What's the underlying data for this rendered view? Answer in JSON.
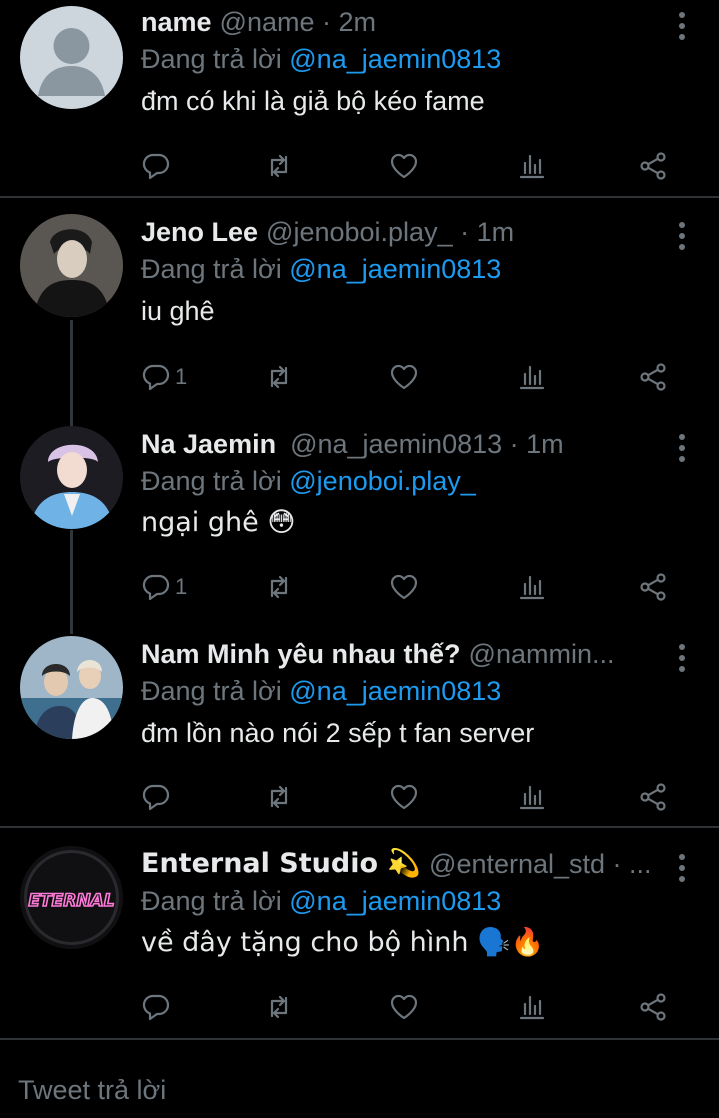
{
  "reply_prefix": "Đang trả lời ",
  "tweets": [
    {
      "name": "name",
      "handle_time": "@name · 2m",
      "reply_to": "@na_jaemin0813",
      "text": "đm có khi là giả bộ kéo fame",
      "reply_count": "",
      "avatar": "default-avatar"
    },
    {
      "name": "Jeno Lee",
      "handle_time": "@jenoboi.play_ · 1m",
      "reply_to": "@na_jaemin0813",
      "text": "iu ghê",
      "reply_count": "1",
      "avatar": "photo-avatar"
    },
    {
      "name": "Na Jaemin",
      "handle_time": "@na_jaemin0813 · 1m",
      "reply_to": "@jenoboi.play_",
      "text": "ngại ghê 😳",
      "reply_count": "1",
      "avatar": "photo-avatar"
    },
    {
      "name": "Nam Minh yêu nhau thế?",
      "handle_time": "@nammin...",
      "reply_to": "@na_jaemin0813",
      "text": "đm lồn nào nói 2 sếp t fan server",
      "reply_count": "",
      "avatar": "photo-avatar"
    },
    {
      "name": "Enternal Studio 💫",
      "handle_time": "@enternal_std · ...",
      "reply_to": "@na_jaemin0813",
      "text": "về đây tặng cho bộ hình 🗣️🔥",
      "reply_count": "",
      "avatar": "logo-avatar",
      "avatar_logo_text": "ETERNAL"
    }
  ],
  "composer": {
    "placeholder": "Tweet trả lời"
  },
  "colors": {
    "background": "#000000",
    "text": "#e7e9ea",
    "muted": "#6e767d",
    "accent": "#1d9bf0",
    "divider": "#2f3336"
  },
  "icons": [
    "reply-icon",
    "retweet-icon",
    "like-icon",
    "stats-icon",
    "share-icon",
    "more-icon"
  ]
}
